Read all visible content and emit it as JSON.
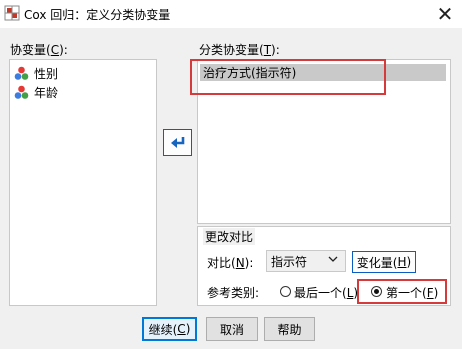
{
  "window": {
    "title": "Cox 回归：定义分类协变量",
    "close_glyph": "✕"
  },
  "covariates": {
    "label_prefix": "协变量(",
    "label_key": "C",
    "label_suffix": "):",
    "items": [
      {
        "label": "性别",
        "icon": "nominal-variable-icon"
      },
      {
        "label": "年龄",
        "icon": "nominal-variable-icon"
      }
    ]
  },
  "categorical": {
    "label_prefix": "分类协变量(",
    "label_key": "T",
    "label_suffix": "):",
    "items": [
      {
        "label": "治疗方式(指示符)"
      }
    ]
  },
  "change_contrast": {
    "title": "更改对比",
    "contrast_prefix": "对比(",
    "contrast_key": "N",
    "contrast_suffix": "):",
    "contrast_value": "指示符",
    "change_prefix": "变化量(",
    "change_key": "H",
    "change_suffix": ")",
    "reference_label": "参考类别:",
    "last_prefix": "最后一个(",
    "last_key": "L",
    "last_suffix": ")",
    "first_prefix": "第一个(",
    "first_key": "F",
    "first_suffix": ")",
    "selected": "first"
  },
  "buttons": {
    "continue_prefix": "继续(",
    "continue_key": "C",
    "continue_suffix": ")",
    "cancel": "取消",
    "help": "帮助"
  },
  "colors": {
    "highlight": "#d63b3b",
    "accent": "#0078d7"
  }
}
